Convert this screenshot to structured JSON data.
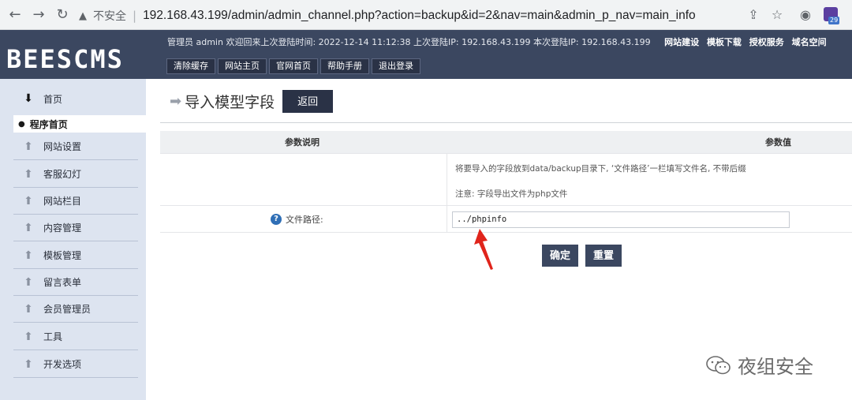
{
  "browser": {
    "security_label": "不安全",
    "url": "192.168.43.199/admin/admin_channel.php?action=backup&id=2&nav=main&admin_p_nav=main_info",
    "ext_badge": "29"
  },
  "header": {
    "logo": "BEESCMS",
    "info": "管理员 admin 欢迎回来上次登陆时间: 2022-12-14 11:12:38 上次登陆IP: 192.168.43.199 本次登陆IP: 192.168.43.199",
    "links": [
      "网站建设",
      "模板下载",
      "授权服务",
      "域名空间"
    ],
    "buttons": [
      "清除缓存",
      "网站主页",
      "官网首页",
      "帮助手册",
      "退出登录"
    ]
  },
  "sidebar": {
    "home": "首页",
    "current": "程序首页",
    "items": [
      "网站设置",
      "客服幻灯",
      "网站栏目",
      "内容管理",
      "模板管理",
      "留言表单",
      "会员管理员",
      "工具",
      "开发选项"
    ]
  },
  "main": {
    "title": "导入模型字段",
    "back_label": "返回",
    "col_desc": "参数说明",
    "col_value": "参数值",
    "desc_line1": "将要导入的字段放到data/backup目录下, ‘文件路径’一栏填写文件名, 不带后缀",
    "desc_line2": "注意: 字段导出文件为php文件",
    "field_label": "文件路径:",
    "field_value": "../phpinfo",
    "confirm_label": "确定",
    "reset_label": "重置"
  },
  "watermark": "夜组安全",
  "colors": {
    "header": "#3b4760",
    "sidebar": "#dde4f0",
    "accent_red": "#e0241b"
  }
}
